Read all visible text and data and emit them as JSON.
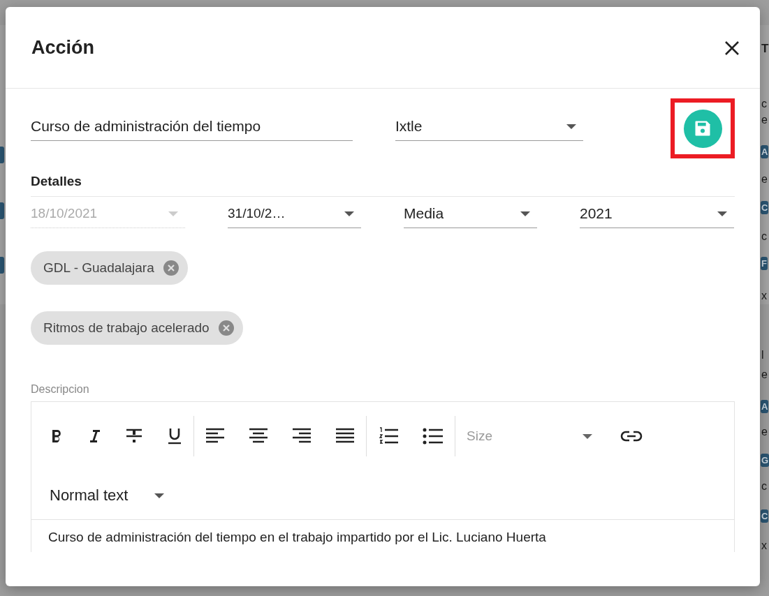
{
  "backdrop": {
    "left": [
      {
        "kind": "tag"
      },
      {
        "kind": "tag"
      },
      {
        "kind": "tag"
      }
    ],
    "right": [
      {
        "kind": "title",
        "text": "T"
      },
      {
        "kind": "text",
        "text": "c"
      },
      {
        "kind": "text",
        "text": "e"
      },
      {
        "kind": "tag",
        "text": "A"
      },
      {
        "kind": "text",
        "text": "e"
      },
      {
        "kind": "tag",
        "text": "C"
      },
      {
        "kind": "text",
        "text": "c"
      },
      {
        "kind": "tag",
        "text": "F"
      },
      {
        "kind": "text",
        "text": "x"
      },
      {
        "kind": "text",
        "text": "l"
      },
      {
        "kind": "text",
        "text": "e"
      },
      {
        "kind": "tag",
        "text": "A"
      },
      {
        "kind": "text",
        "text": "e"
      },
      {
        "kind": "tag",
        "text": "G"
      },
      {
        "kind": "text",
        "text": "c"
      },
      {
        "kind": "tag",
        "text": "C"
      },
      {
        "kind": "text",
        "text": "x"
      }
    ]
  },
  "dialog": {
    "title": "Acción",
    "name_field": {
      "value": "Curso de administración del tiempo"
    },
    "material_select": {
      "value": "Ixtle"
    },
    "save_button": {
      "highlighted": true
    },
    "section_title": "Detalles",
    "detail_selects": [
      {
        "value": "18/10/2021",
        "disabled": true
      },
      {
        "value": "31/10/2…",
        "disabled": false
      },
      {
        "value": "Media",
        "disabled": false
      },
      {
        "value": "2021",
        "disabled": false
      }
    ],
    "chips": [
      {
        "label": "GDL - Guadalajara"
      },
      {
        "label": "Ritmos de trabajo acelerado"
      }
    ],
    "description": {
      "label": "Descripcion",
      "toolbar": [
        [
          {
            "kind": "bold"
          },
          {
            "kind": "italic"
          },
          {
            "kind": "strike"
          },
          {
            "kind": "underline"
          }
        ],
        [
          {
            "kind": "align-left"
          },
          {
            "kind": "align-center"
          },
          {
            "kind": "align-right"
          },
          {
            "kind": "justify"
          }
        ],
        [
          {
            "kind": "ordered-list"
          },
          {
            "kind": "bullet-list"
          }
        ],
        [
          {
            "kind": "size",
            "placeholder": "Size"
          },
          {
            "kind": "link"
          }
        ]
      ],
      "format": "Normal text",
      "text": "Curso de administración del tiempo en el trabajo impartido por el Lic. Luciano Huerta"
    }
  }
}
